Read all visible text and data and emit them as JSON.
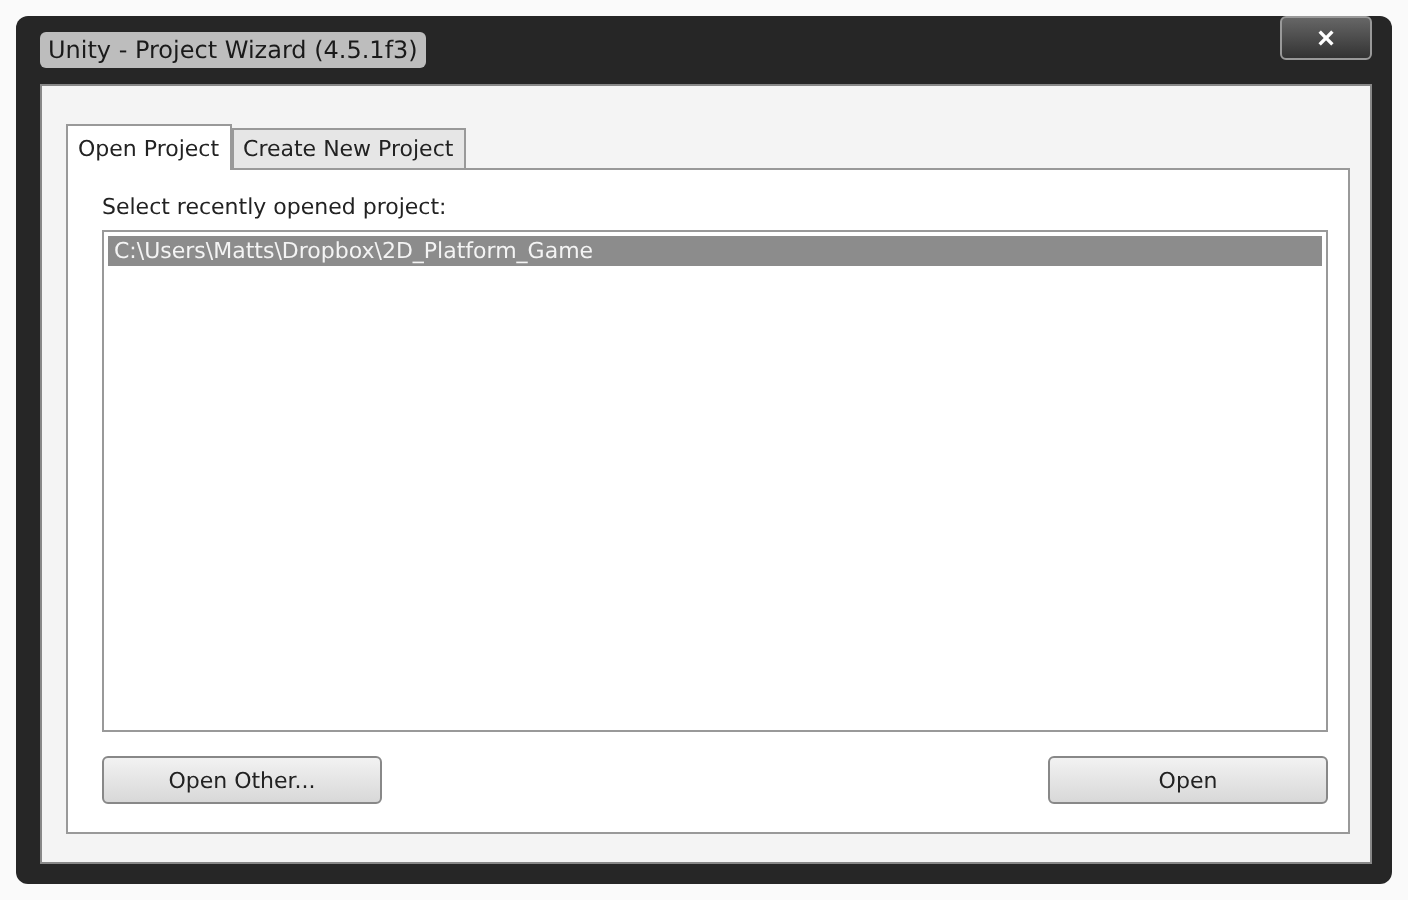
{
  "window": {
    "title": "Unity - Project Wizard (4.5.1f3)",
    "close": "×"
  },
  "tabs": [
    {
      "label": "Open Project",
      "selected": true
    },
    {
      "label": "Create New Project",
      "selected": false
    }
  ],
  "list_label": "Select recently opened project:",
  "projects": [
    {
      "path": "C:\\Users\\Matts\\Dropbox\\2D_Platform_Game",
      "selected": true
    }
  ],
  "buttons": {
    "open_other": "Open Other...",
    "open": "Open"
  }
}
